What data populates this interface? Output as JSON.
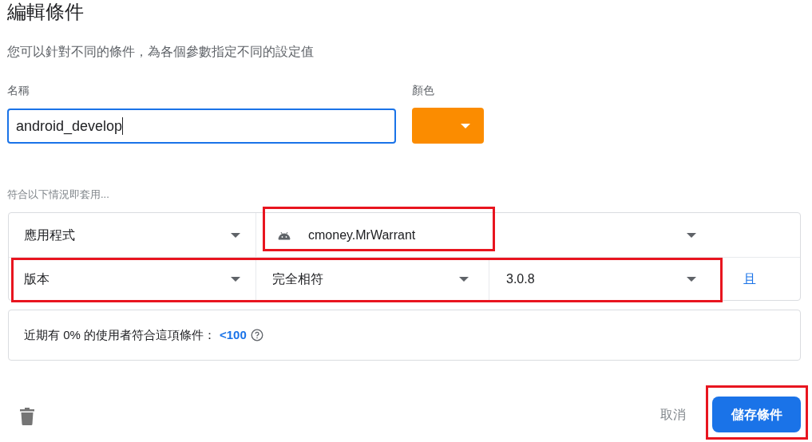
{
  "title": "編輯條件",
  "description": "您可以針對不同的條件，為各個參數指定不同的設定值",
  "name_field": {
    "label": "名稱",
    "value": "android_develop",
    "focused": true
  },
  "color_field": {
    "label": "顏色",
    "color": "#fb8c00"
  },
  "conditions_label": "符合以下情況即套用...",
  "conditions": [
    {
      "kind": "app",
      "field": "應用程式",
      "value": "cmoney.MrWarrant",
      "value_highlighted": true
    },
    {
      "kind": "version",
      "field": "版本",
      "operator": "完全相符",
      "value": "3.0.8",
      "and_link": "且",
      "row_highlighted": true
    }
  ],
  "info": {
    "text": "近期有 0% 的使用者符合這項條件：",
    "count": "<100"
  },
  "buttons": {
    "cancel": "取消",
    "save": "儲存條件",
    "save_highlight": true
  }
}
